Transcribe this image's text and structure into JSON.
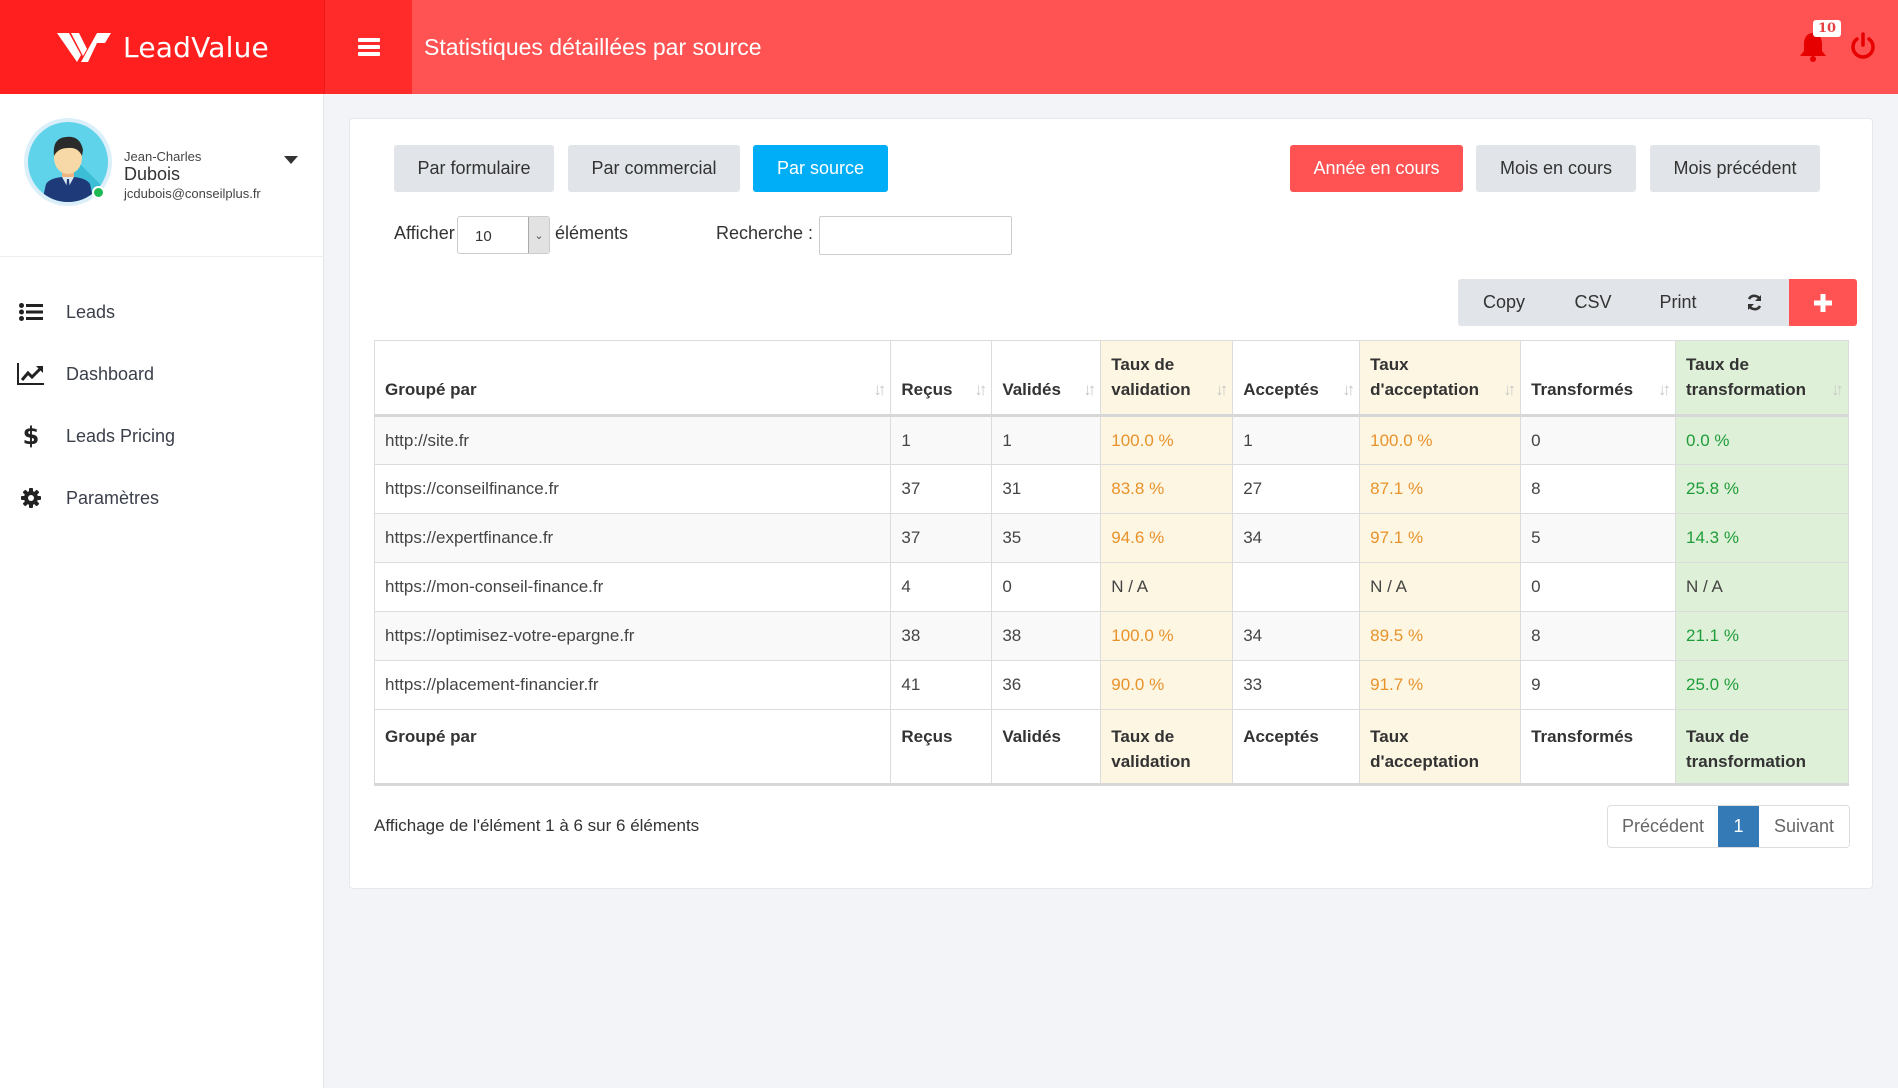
{
  "app": {
    "brand": "LeadValue",
    "page_title": "Statistiques détaillées par source",
    "notification_count": "10",
    "colors": {
      "brand_red": "#ff1f1f",
      "header_red": "#ff5252",
      "active_blue": "#00aef7",
      "rate_orange": "#e8922c",
      "rate_green": "#1f9d3a",
      "pager_blue": "#337ab7"
    }
  },
  "profile": {
    "first_name": "Jean-Charles",
    "last_name": "Dubois",
    "email": "jcdubois@conseilplus.fr",
    "status": "online"
  },
  "sidebar": {
    "items": [
      {
        "label": "Leads",
        "icon": "list-icon"
      },
      {
        "label": "Dashboard",
        "icon": "line-chart-icon"
      },
      {
        "label": "Leads Pricing",
        "icon": "dollar-icon"
      },
      {
        "label": "Paramètres",
        "icon": "gear-icon"
      }
    ]
  },
  "filters": {
    "group_by": [
      {
        "label": "Par formulaire",
        "active": false
      },
      {
        "label": "Par commercial",
        "active": false
      },
      {
        "label": "Par source",
        "active": true
      }
    ],
    "period": [
      {
        "label": "Année en cours",
        "active": true
      },
      {
        "label": "Mois en cours",
        "active": false
      },
      {
        "label": "Mois précédent",
        "active": false
      }
    ]
  },
  "table_controls": {
    "show_label": "Afficher",
    "page_length": "10",
    "elements_label": "éléments",
    "search_label": "Recherche :",
    "search_value": "",
    "export_buttons": {
      "copy": "Copy",
      "csv": "CSV",
      "print": "Print"
    },
    "refresh_icon": "refresh-icon",
    "add_icon": "plus-icon"
  },
  "table": {
    "columns": [
      "Groupé par",
      "Reçus",
      "Validés",
      "Taux de validation",
      "Acceptés",
      "Taux d'acceptation",
      "Transformés",
      "Taux de transformation"
    ],
    "header_lines": [
      [
        "Groupé par"
      ],
      [
        "Reçus"
      ],
      [
        "Validés"
      ],
      [
        "Taux de",
        "validation"
      ],
      [
        "Acceptés"
      ],
      [
        "Taux",
        "d'acceptation"
      ],
      [
        "Transformés"
      ],
      [
        "Taux de",
        "transformation"
      ]
    ],
    "rows": [
      [
        "http://site.fr",
        "1",
        "1",
        "100.0 %",
        "1",
        "100.0 %",
        "0",
        "0.0 %"
      ],
      [
        "https://conseilfinance.fr",
        "37",
        "31",
        "83.8 %",
        "27",
        "87.1 %",
        "8",
        "25.8 %"
      ],
      [
        "https://expertfinance.fr",
        "37",
        "35",
        "94.6 %",
        "34",
        "97.1 %",
        "5",
        "14.3 %"
      ],
      [
        "https://mon-conseil-finance.fr",
        "4",
        "0",
        "N / A",
        "",
        "N / A",
        "0",
        "N / A"
      ],
      [
        "https://optimisez-votre-epargne.fr",
        "38",
        "38",
        "100.0 %",
        "34",
        "89.5 %",
        "8",
        "21.1 %"
      ],
      [
        "https://placement-financier.fr",
        "41",
        "36",
        "90.0 %",
        "33",
        "91.7 %",
        "9",
        "25.0 %"
      ]
    ]
  },
  "footer": {
    "info": "Affichage de l'élément 1 à 6 sur 6 éléments",
    "pagination": {
      "prev": "Précédent",
      "current": "1",
      "next": "Suivant"
    }
  }
}
